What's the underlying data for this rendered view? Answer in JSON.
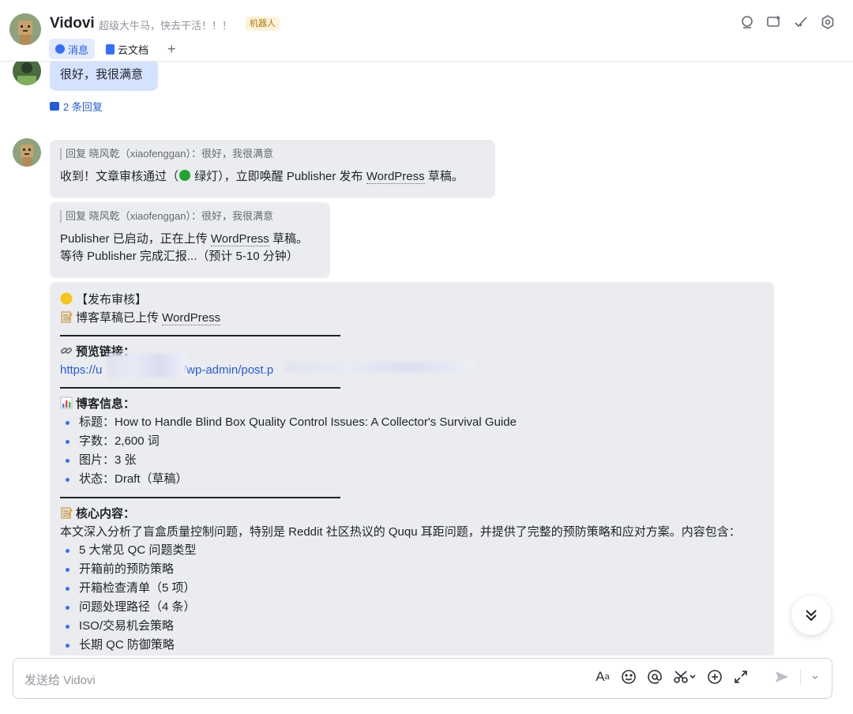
{
  "header": {
    "name": "Vidovi",
    "signature": "超级大牛马，快去干活！！！",
    "badge": "机器人",
    "tabs": [
      {
        "label": "消息",
        "active": true
      },
      {
        "label": "云文档",
        "active": false
      }
    ],
    "add_tab": "+"
  },
  "messages": {
    "prev": {
      "text": "很好，我很满意",
      "replies": "2 条回复"
    },
    "m1": {
      "quote": "回复 晓风乾（xiaofenggan）：很好，我很满意",
      "text_a": "收到！文章审核通过（",
      "text_b": " 绿灯），立即唤醒 Publisher 发布 ",
      "wp": "WordPress",
      "text_c": " 草稿。"
    },
    "m2": {
      "quote": "回复 晓风乾（xiaofenggan）：很好，我很满意",
      "line1_a": "Publisher 已启动，正在上传 ",
      "line1_wp": "WordPress",
      "line1_b": " 草稿。",
      "line2": "等待 Publisher 完成汇报...（预计 5-10 分钟）"
    },
    "m3": {
      "title": "【发布审核】",
      "subtitle_a": "博客草稿已上传 ",
      "subtitle_wp": "WordPress",
      "preview_label": "预览链接：",
      "link_start": "https://u",
      "link_mid": "/wp-admin/post.p",
      "info_label": "博客信息：",
      "info": [
        "标题：How to Handle Blind Box Quality Control Issues: A Collector's Survival Guide",
        "字数：2,600 词",
        "图片：3 张",
        "状态：Draft（草稿）"
      ],
      "core_label": "核心内容：",
      "core_text": "本文深入分析了盲盒质量控制问题，特别是 Reddit 社区热议的 Ququ 耳距问题，并提供了完整的预防策略和应对方案。内容包含：",
      "core_items": [
        "5 大常见 QC 问题类型",
        "开箱前的预防策略",
        "开箱检查清单（5 项）",
        "问题处理路径（4 条）",
        "ISO/交易机会策略",
        "长期 QC 防御策略"
      ]
    }
  },
  "input": {
    "placeholder": "发送给 Vidovi"
  },
  "colors": {
    "accent": "#3370ff",
    "bubble": "#ebecef",
    "bubble_self": "#d4e2ff",
    "badge_bg": "#fdf3d9"
  },
  "icons": [
    "search-icon",
    "new-topic-icon",
    "done-icon",
    "settings-icon",
    "scroll-down-icon",
    "font-icon",
    "emoji-icon",
    "mention-icon",
    "scissors-icon",
    "plus-circle-icon",
    "expand-icon",
    "send-icon",
    "chevron-down-icon"
  ]
}
